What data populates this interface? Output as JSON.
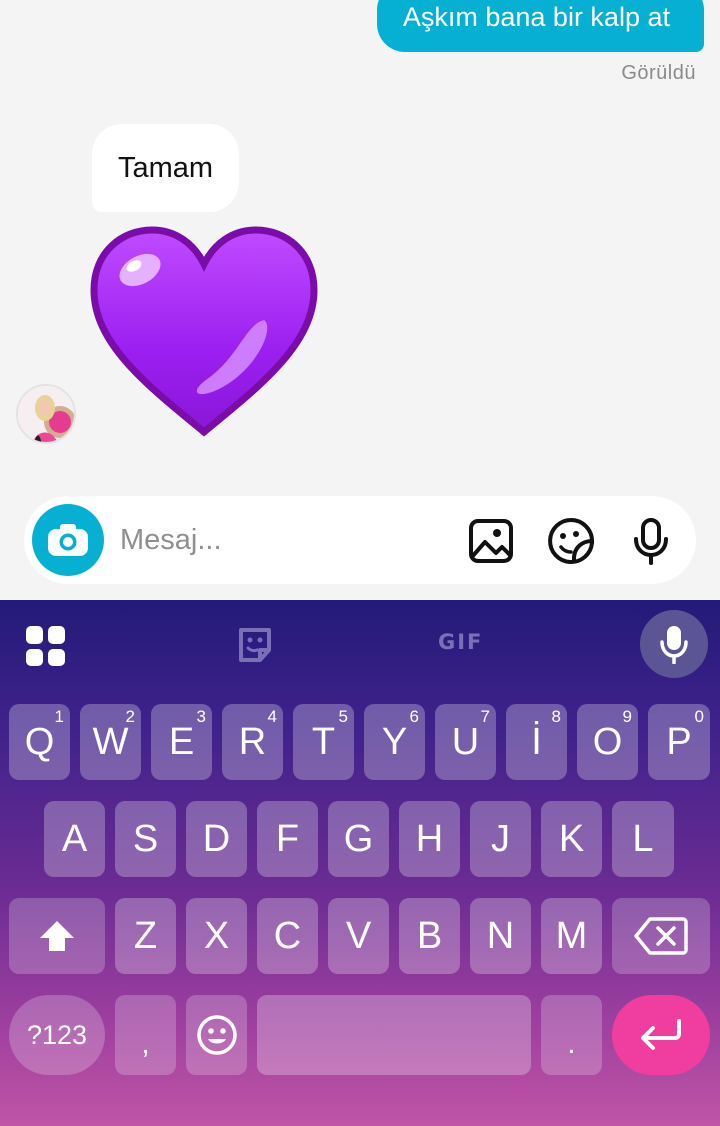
{
  "chat": {
    "outgoing_message": "Aşkım bana bir kalp at",
    "seen_status": "Görüldü",
    "incoming_message": "Tamam",
    "emoji": "purple-heart"
  },
  "composer": {
    "placeholder": "Mesaj..."
  },
  "keyboard": {
    "gif_label": "GIF",
    "row1": [
      {
        "label": "Q",
        "hint": "1"
      },
      {
        "label": "W",
        "hint": "2"
      },
      {
        "label": "E",
        "hint": "3"
      },
      {
        "label": "R",
        "hint": "4"
      },
      {
        "label": "T",
        "hint": "5"
      },
      {
        "label": "Y",
        "hint": "6"
      },
      {
        "label": "U",
        "hint": "7"
      },
      {
        "label": "İ",
        "hint": "8"
      },
      {
        "label": "O",
        "hint": "9"
      },
      {
        "label": "P",
        "hint": "0"
      }
    ],
    "row2": [
      "A",
      "S",
      "D",
      "F",
      "G",
      "H",
      "J",
      "K",
      "L"
    ],
    "row3": [
      "Z",
      "X",
      "C",
      "V",
      "B",
      "N",
      "M"
    ],
    "symbols_label": "?123",
    "comma_label": ",",
    "period_label": "."
  },
  "colors": {
    "accent": "#05b0d3",
    "enter_key": "#f03ea0",
    "heart": "#a020f0"
  }
}
